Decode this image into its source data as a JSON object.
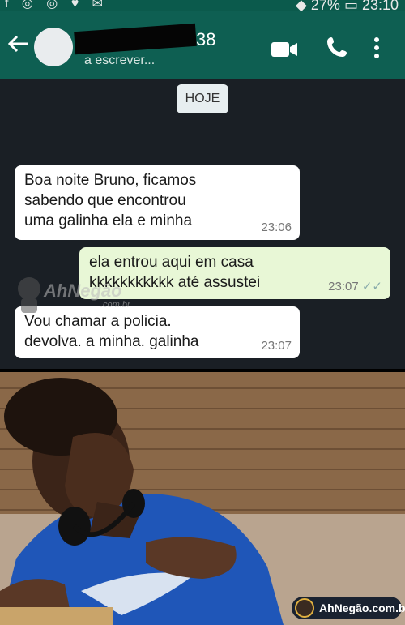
{
  "status_bar": {
    "left_icons": "f ◎ ◎ ♥ ✉",
    "battery": "27%",
    "clock": "23:10"
  },
  "header": {
    "contact_suffix": "38",
    "status": "a escrever..."
  },
  "icons": {
    "back": "arrow-left",
    "video": "video-camera",
    "call": "phone",
    "menu": "more-vert"
  },
  "chat": {
    "date_label": "HOJE",
    "messages": [
      {
        "line1": "Boa noite  Bruno, ficamos",
        "line2": "sabendo que encontrou",
        "line3": "uma galinha ela e minha",
        "time": "23:06"
      },
      {
        "line1": "ela entrou aqui em casa",
        "line2": "kkkkkkkkkkk até assustei",
        "time": "23:07",
        "ticks": "✓✓"
      },
      {
        "line1": "Vou chamar a policia.",
        "line2": "devolva.   a minha. galinha",
        "time": "23:07"
      }
    ]
  },
  "watermark": {
    "brand": "AhNegão",
    "domain": ".com.br"
  },
  "footer_badge": {
    "text": "AhNegão.com.br"
  },
  "colors": {
    "appbar": "#0e5f52",
    "chat_bg": "#1a1f25",
    "incoming": "#ffffff",
    "outgoing": "#e8f7d6"
  }
}
